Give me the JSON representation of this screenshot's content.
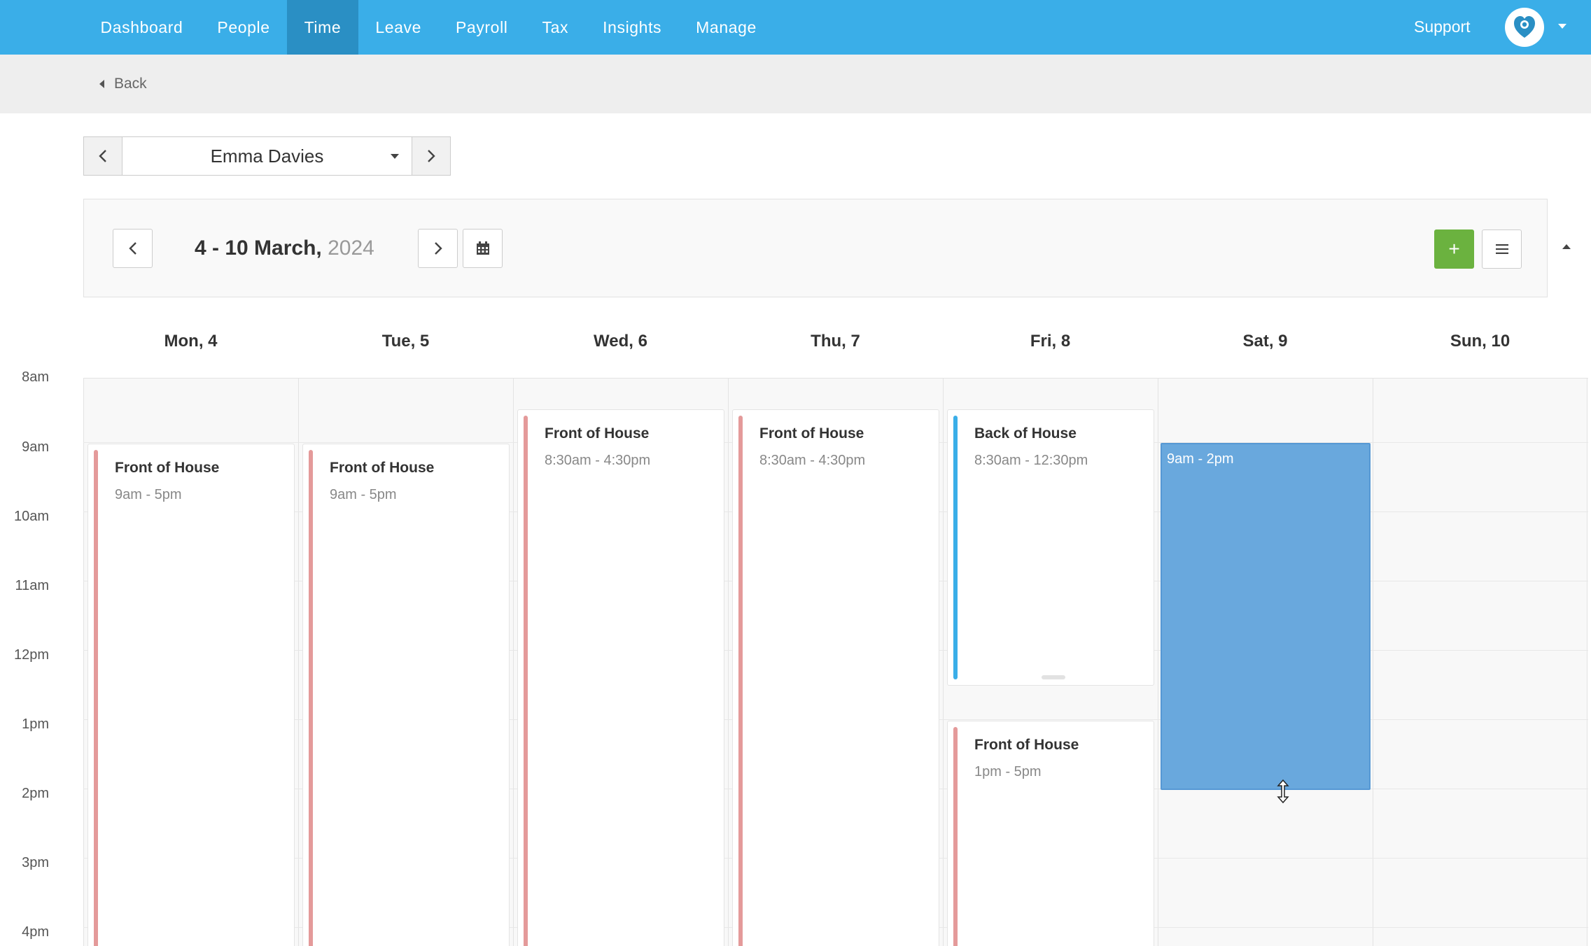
{
  "nav": {
    "items": [
      {
        "label": "Dashboard"
      },
      {
        "label": "People"
      },
      {
        "label": "Time"
      },
      {
        "label": "Leave"
      },
      {
        "label": "Payroll"
      },
      {
        "label": "Tax"
      },
      {
        "label": "Insights"
      },
      {
        "label": "Manage"
      }
    ],
    "active": "Time",
    "support_label": "Support",
    "accent_color": "#3aaee8"
  },
  "subbar": {
    "back_label": "Back"
  },
  "employee_selector": {
    "selected": "Emma Davies"
  },
  "toolbar": {
    "date_range": "4 - 10 March,",
    "year": "2024",
    "add_label": "+",
    "add_color": "#6bb23f"
  },
  "days": [
    {
      "label": "Mon, 4"
    },
    {
      "label": "Tue, 5"
    },
    {
      "label": "Wed, 6"
    },
    {
      "label": "Thu, 7"
    },
    {
      "label": "Fri, 8"
    },
    {
      "label": "Sat, 9"
    },
    {
      "label": "Sun, 10"
    }
  ],
  "time_labels": [
    "8am",
    "9am",
    "10am",
    "11am",
    "12pm",
    "1pm",
    "2pm",
    "3pm",
    "4pm"
  ],
  "shifts": [
    {
      "day": "Mon, 4",
      "title": "Front of House",
      "time": "9am - 5pm",
      "color": "#e49a9a"
    },
    {
      "day": "Tue, 5",
      "title": "Front of House",
      "time": "9am - 5pm",
      "color": "#e49a9a"
    },
    {
      "day": "Wed, 6",
      "title": "Front of House",
      "time": "8:30am - 4:30pm",
      "color": "#e49a9a"
    },
    {
      "day": "Thu, 7",
      "title": "Front of House",
      "time": "8:30am - 4:30pm",
      "color": "#e49a9a"
    },
    {
      "day": "Fri, 8",
      "title": "Back of House",
      "time": "8:30am - 12:30pm",
      "color": "#3aaee8"
    },
    {
      "day": "Fri, 8",
      "title": "Front of House",
      "time": "1pm - 5pm",
      "color": "#e49a9a"
    }
  ],
  "new_shift": {
    "day": "Sat, 9",
    "time": "9am - 2pm",
    "color": "#69a8dd"
  }
}
